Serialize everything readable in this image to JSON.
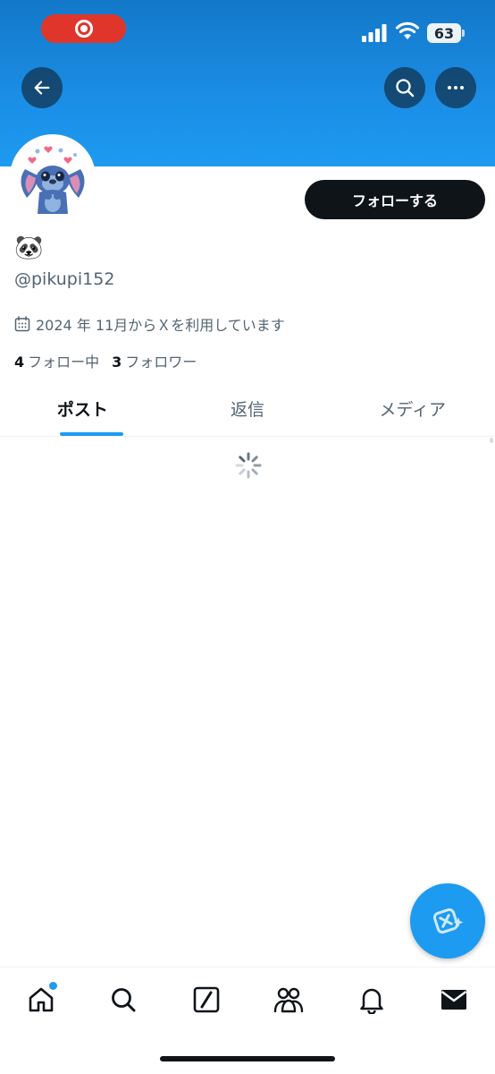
{
  "status_bar": {
    "battery": "63",
    "icons": [
      "screen-recording-icon",
      "signal-icon",
      "wifi-icon",
      "battery-icon"
    ]
  },
  "header": {
    "banner_color": "#1d9bf0",
    "icons": [
      "back-arrow-icon",
      "search-icon",
      "more-icon"
    ]
  },
  "profile": {
    "avatar": "stitch-avatar",
    "display_name": "🐼",
    "handle": "@pikupi152",
    "joined": "2024 年 11月からＸを利用しています",
    "following_count": "4",
    "following_label": "フォロー中",
    "followers_count": "3",
    "followers_label": "フォロワー",
    "follow_button_label": "フォローする"
  },
  "tabs": [
    {
      "label": "ポスト",
      "active": true
    },
    {
      "label": "返信",
      "active": false
    },
    {
      "label": "メディア",
      "active": false
    }
  ],
  "content": {
    "loading": true
  },
  "fab": {
    "icon": "grok-compose-icon",
    "color": "#1d9bf0"
  },
  "bottom_nav": {
    "items": [
      "home-icon",
      "search-icon",
      "grok-icon",
      "communities-icon",
      "notifications-icon",
      "messages-icon"
    ],
    "home_badge": true
  },
  "colors": {
    "accent": "#1d9bf0",
    "text_primary": "#0f1419",
    "text_secondary": "#536471"
  }
}
